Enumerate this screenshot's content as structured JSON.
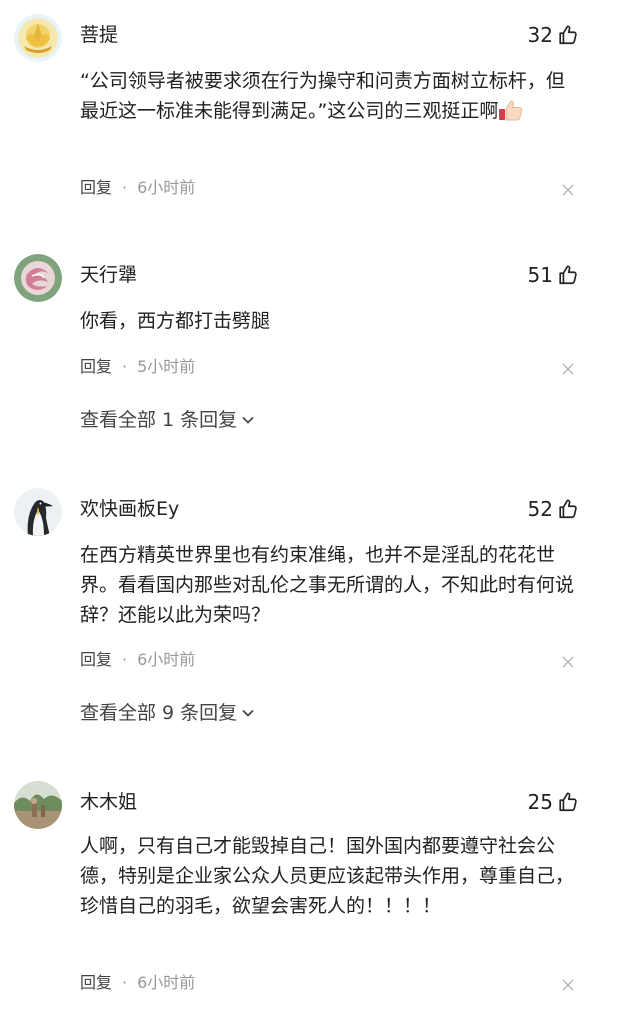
{
  "comments": [
    {
      "username": "菩提",
      "likes": "32",
      "content": "“公司领导者被要求须在行为操守和问责方面树立标杆，但最近这一标准未能得到满足。”这公司的三观挺正啊",
      "reply_label": "回复",
      "separator": "·",
      "time": "6小时前",
      "avatar_icon": "lotus-avatar",
      "emoji_icon": "thumbs-up-emoji"
    },
    {
      "username": "天行犟",
      "likes": "51",
      "content": "你看，西方都打击劈腿",
      "reply_label": "回复",
      "separator": "·",
      "time": "5小时前",
      "view_replies": "查看全部 1 条回复",
      "avatar_icon": "spiral-avatar"
    },
    {
      "username": "欢快画板Ey",
      "likes": "52",
      "content": "在西方精英世界里也有约束准绳，也并不是淫乱的花花世界。看看国内那些对乱伦之事无所谓的人，不知此时有何说辞？还能以此为荣吗？",
      "reply_label": "回复",
      "separator": "·",
      "time": "6小时前",
      "view_replies": "查看全部 9 条回复",
      "avatar_icon": "penguin-avatar"
    },
    {
      "username": "木木姐",
      "likes": "25",
      "content": "人啊，只有自己才能毁掉自己！国外国内都要遵守社会公德，特别是企业家公众人员更应该起带头作用，尊重自己，珍惜自己的羽毛，欲望会害死人的！！！！",
      "reply_label": "回复",
      "separator": "·",
      "time": "6小时前",
      "avatar_icon": "garden-avatar"
    }
  ],
  "colors": {
    "text": "#222222",
    "meta": "#999999",
    "reply": "#444444"
  }
}
